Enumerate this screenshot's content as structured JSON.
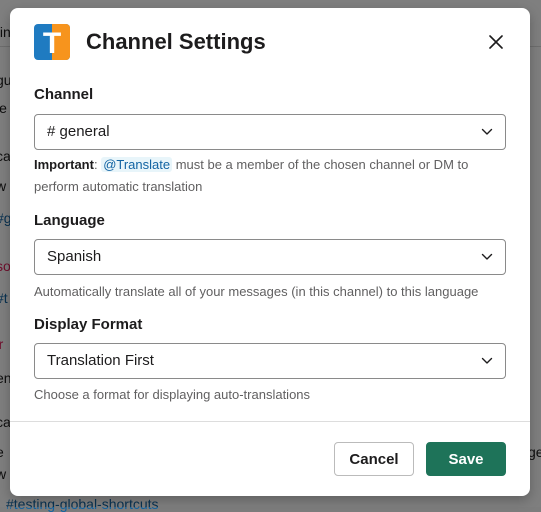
{
  "background": {
    "lines": [
      {
        "text": "tin"
      },
      {
        "text": "gu"
      },
      {
        "text": "le"
      },
      {
        "text": "ca"
      },
      {
        "text": "w"
      },
      {
        "text": "#g"
      },
      {
        "text": "so"
      },
      {
        "text": "#t"
      },
      {
        "text": "'r"
      },
      {
        "text": "en"
      },
      {
        "text": "ca"
      },
      {
        "text": "e"
      },
      {
        "text": "ge"
      },
      {
        "text": "w"
      },
      {
        "text": "#testing-global-shortcuts"
      }
    ]
  },
  "modal": {
    "title": "Channel Settings",
    "logo_letter": "T",
    "close_icon": "close-icon",
    "channel": {
      "label": "Channel",
      "value": "# general",
      "hint_important": "Important",
      "hint_colon": ": ",
      "hint_mention": "@Translate",
      "hint_rest": " must be a member of the chosen channel or DM to perform automatic translation"
    },
    "language": {
      "label": "Language",
      "value": "Spanish",
      "hint": "Automatically translate all of your messages (in this channel) to this language"
    },
    "display_format": {
      "label": "Display Format",
      "value": "Translation First",
      "hint": "Choose a format for displaying auto-translations"
    },
    "buttons": {
      "cancel": "Cancel",
      "save": "Save"
    }
  },
  "colors": {
    "save_button": "#1e7359",
    "mention_text": "#1264a3",
    "logo_blue": "#1f7bc1",
    "logo_orange": "#f7941d"
  }
}
